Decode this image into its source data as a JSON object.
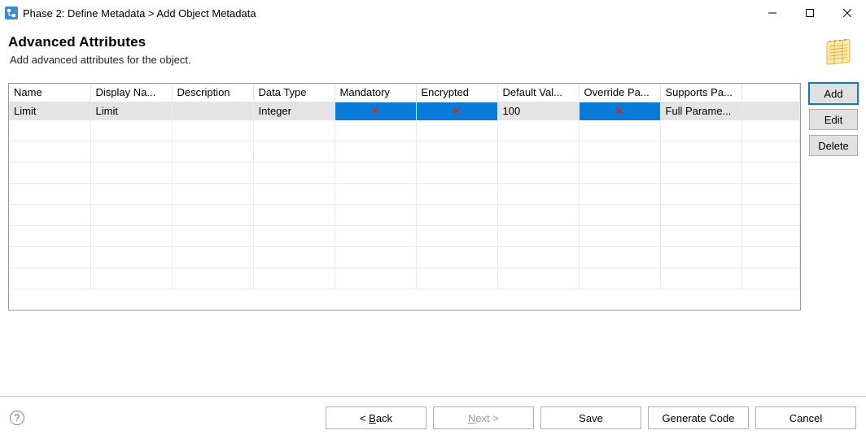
{
  "window": {
    "title": "Phase 2: Define Metadata > Add Object Metadata"
  },
  "header": {
    "title": "Advanced Attributes",
    "subtitle": "Add advanced attributes for the object."
  },
  "table": {
    "columns": [
      "Name",
      "Display Na...",
      "Description",
      "Data Type",
      "Mandatory",
      "Encrypted",
      "Default Val...",
      "Override Pa...",
      "Supports Pa..."
    ],
    "rows": [
      {
        "name": "Limit",
        "display_name": "Limit",
        "description": "",
        "data_type": "Integer",
        "mandatory": false,
        "encrypted": false,
        "default_value": "100",
        "override_parent": false,
        "supports_parent": "Full Parame..."
      }
    ]
  },
  "side_buttons": {
    "add": "Add",
    "edit": "Edit",
    "delete": "Delete"
  },
  "footer": {
    "back": "< Back",
    "next": "Next >",
    "save": "Save",
    "generate": "Generate Code",
    "cancel": "Cancel"
  }
}
